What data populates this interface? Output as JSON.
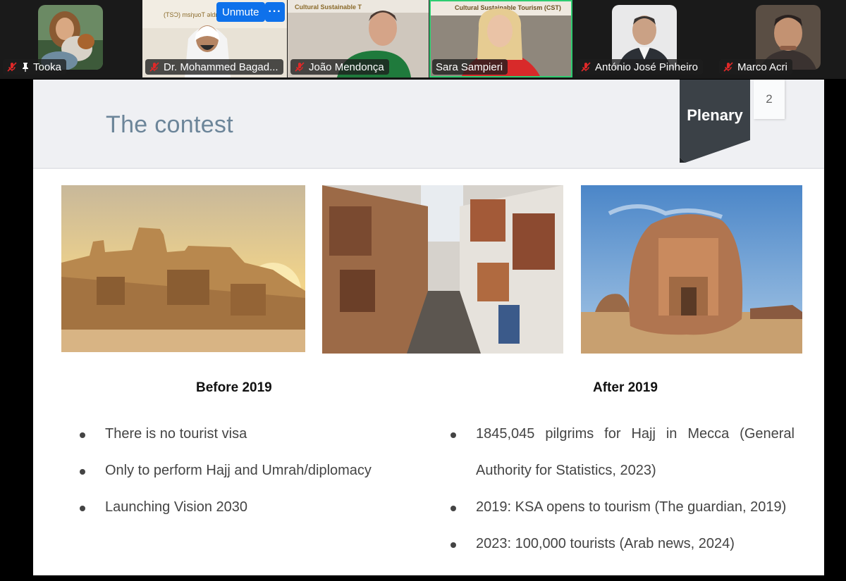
{
  "participants": [
    {
      "name": "Tooka",
      "muted": true,
      "pinned": true
    },
    {
      "name": "Dr. Mohammed Bagad...",
      "muted": true
    },
    {
      "name": "João Mendonça",
      "muted": true
    },
    {
      "name": "Sara Sampieri",
      "muted": true,
      "active": true
    },
    {
      "name": "António José Pinheiro",
      "muted": true
    },
    {
      "name": "Marco Acri",
      "muted": true
    }
  ],
  "controls": {
    "unmute_label": "Unmute",
    "more_label": "···"
  },
  "slide": {
    "title": "The contest",
    "badge": "Plenary",
    "page_number": "2",
    "before": {
      "heading": "Before 2019",
      "bullets": [
        "There is no tourist visa",
        "Only to perform Hajj and Umrah/diplomacy",
        "Launching Vision 2030"
      ]
    },
    "after": {
      "heading": "After 2019",
      "bullets": [
        "1845,045 pilgrims for Hajj in Mecca (General",
        "Authority for Statistics, 2023)",
        "2019: KSA opens to tourism (The guardian, 2019)",
        "2023: 100,000 tourists (Arab news, 2024)"
      ]
    }
  },
  "colors": {
    "active_speaker": "#2ecc71",
    "zoom_blue": "#0e71eb",
    "plenary_badge": "#3b4147",
    "title": "#6c8599"
  }
}
